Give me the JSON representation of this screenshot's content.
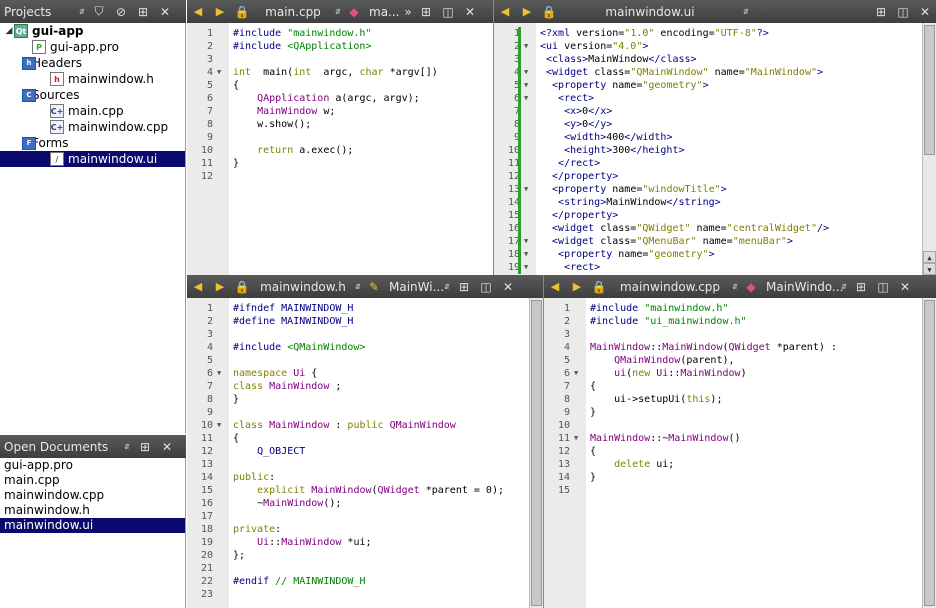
{
  "projects_panel": {
    "title": "Projects",
    "tree": [
      {
        "label": "gui-app",
        "icon": "qt-project-icon",
        "bold": true,
        "expanded": true,
        "level": 0
      },
      {
        "label": "gui-app.pro",
        "icon": "pro-file-icon",
        "level": 1
      },
      {
        "label": "Headers",
        "icon": "headers-folder-icon",
        "expanded": true,
        "level": 1
      },
      {
        "label": "mainwindow.h",
        "icon": "header-file-icon",
        "level": 2
      },
      {
        "label": "Sources",
        "icon": "sources-folder-icon",
        "expanded": true,
        "level": 1
      },
      {
        "label": "main.cpp",
        "icon": "cpp-file-icon",
        "level": 2
      },
      {
        "label": "mainwindow.cpp",
        "icon": "cpp-file-icon",
        "level": 2
      },
      {
        "label": "Forms",
        "icon": "forms-folder-icon",
        "expanded": true,
        "level": 1
      },
      {
        "label": "mainwindow.ui",
        "icon": "ui-file-icon",
        "level": 2,
        "selected": true
      }
    ]
  },
  "open_documents": {
    "title": "Open Documents",
    "items": [
      {
        "label": "gui-app.pro"
      },
      {
        "label": "main.cpp"
      },
      {
        "label": "mainwindow.cpp"
      },
      {
        "label": "mainwindow.h"
      },
      {
        "label": "mainwindow.ui",
        "selected": true
      }
    ]
  },
  "editors": {
    "main_cpp": {
      "file": "main.cpp",
      "symbol": "ma...",
      "lines": [
        [
          [
            "pp",
            "#include "
          ],
          [
            "inc",
            "\"mainwindow.h\""
          ]
        ],
        [
          [
            "pp",
            "#include "
          ],
          [
            "inc",
            "<QApplication>"
          ]
        ],
        [],
        [
          [
            "kw",
            "int"
          ],
          [
            "",
            "  main("
          ],
          [
            "kw",
            "int"
          ],
          [
            "",
            "  argc, "
          ],
          [
            "kw",
            "char"
          ],
          [
            "",
            " *argv[])"
          ]
        ],
        [
          [
            "",
            "{"
          ]
        ],
        [
          [
            "",
            "    "
          ],
          [
            "ty",
            "QApplication"
          ],
          [
            "",
            " a(argc, argv);"
          ]
        ],
        [
          [
            "",
            "    "
          ],
          [
            "ty",
            "MainWindow"
          ],
          [
            "",
            " w;"
          ]
        ],
        [
          [
            "",
            "    w.show();"
          ]
        ],
        [],
        [
          [
            "",
            "    "
          ],
          [
            "kw",
            "return"
          ],
          [
            "",
            " a.exec();"
          ]
        ],
        [
          [
            "",
            "}"
          ]
        ],
        []
      ],
      "folds": [
        4
      ]
    },
    "mainwindow_ui": {
      "file": "mainwindow.ui",
      "lines": [
        [
          [
            "xm",
            "<?xml"
          ],
          [
            "",
            " version="
          ],
          [
            "xa",
            "\"1.0\""
          ],
          [
            "",
            " encoding="
          ],
          [
            "xa",
            "\"UTF-8\""
          ],
          [
            "xm",
            "?>"
          ]
        ],
        [
          [
            "xm",
            "<ui"
          ],
          [
            "",
            " version="
          ],
          [
            "xa",
            "\"4.0\""
          ],
          [
            "xm",
            ">"
          ]
        ],
        [
          [
            "",
            ""
          ],
          [
            "xm",
            " <class>"
          ],
          [
            "",
            "MainWindow"
          ],
          [
            "xm",
            "</class>"
          ]
        ],
        [
          [
            "xm",
            " <widget"
          ],
          [
            "",
            " class="
          ],
          [
            "xa",
            "\"QMainWindow\""
          ],
          [
            "",
            " name="
          ],
          [
            "xa",
            "\"MainWindow\""
          ],
          [
            "xm",
            ">"
          ]
        ],
        [
          [
            "xm",
            "  <property"
          ],
          [
            "",
            " name="
          ],
          [
            "xa",
            "\"geometry\""
          ],
          [
            "xm",
            ">"
          ]
        ],
        [
          [
            "xm",
            "   <rect>"
          ]
        ],
        [
          [
            "xm",
            "    <x>"
          ],
          [
            "",
            "0"
          ],
          [
            "xm",
            "</x>"
          ]
        ],
        [
          [
            "xm",
            "    <y>"
          ],
          [
            "",
            "0"
          ],
          [
            "xm",
            "</y>"
          ]
        ],
        [
          [
            "xm",
            "    <width>"
          ],
          [
            "",
            "400"
          ],
          [
            "xm",
            "</width>"
          ]
        ],
        [
          [
            "xm",
            "    <height>"
          ],
          [
            "",
            "300"
          ],
          [
            "xm",
            "</height>"
          ]
        ],
        [
          [
            "xm",
            "   </rect>"
          ]
        ],
        [
          [
            "xm",
            "  </property>"
          ]
        ],
        [
          [
            "xm",
            "  <property"
          ],
          [
            "",
            " name="
          ],
          [
            "xa",
            "\"windowTitle\""
          ],
          [
            "xm",
            ">"
          ]
        ],
        [
          [
            "xm",
            "   <string>"
          ],
          [
            "",
            "MainWindow"
          ],
          [
            "xm",
            "</string>"
          ]
        ],
        [
          [
            "xm",
            "  </property>"
          ]
        ],
        [
          [
            "xm",
            "  <widget"
          ],
          [
            "",
            " class="
          ],
          [
            "xa",
            "\"QWidget\""
          ],
          [
            "",
            " name="
          ],
          [
            "xa",
            "\"centralWidget\""
          ],
          [
            "xm",
            "/>"
          ]
        ],
        [
          [
            "xm",
            "  <widget"
          ],
          [
            "",
            " class="
          ],
          [
            "xa",
            "\"QMenuBar\""
          ],
          [
            "",
            " name="
          ],
          [
            "xa",
            "\"menuBar\""
          ],
          [
            "xm",
            ">"
          ]
        ],
        [
          [
            "xm",
            "   <property"
          ],
          [
            "",
            " name="
          ],
          [
            "xa",
            "\"geometry\""
          ],
          [
            "xm",
            ">"
          ]
        ],
        [
          [
            "xm",
            "    <rect>"
          ]
        ]
      ],
      "folds": [
        2,
        4,
        5,
        6,
        13,
        17,
        18,
        19
      ]
    },
    "mainwindow_h": {
      "file": "mainwindow.h",
      "symbol": "MainWi...",
      "lines": [
        [
          [
            "pp",
            "#ifndef MAINWINDOW_H"
          ]
        ],
        [
          [
            "pp",
            "#define MAINWINDOW_H"
          ]
        ],
        [],
        [
          [
            "pp",
            "#include "
          ],
          [
            "inc",
            "<QMainWindow>"
          ]
        ],
        [],
        [
          [
            "kw",
            "namespace"
          ],
          [
            "",
            " "
          ],
          [
            "ty",
            "Ui"
          ],
          [
            "",
            " {"
          ]
        ],
        [
          [
            "kw",
            "class"
          ],
          [
            "",
            " "
          ],
          [
            "ty",
            "MainWindow"
          ],
          [
            ";",
            " ;"
          ]
        ],
        [
          [
            "",
            "}"
          ]
        ],
        [],
        [
          [
            "kw",
            "class"
          ],
          [
            "",
            " "
          ],
          [
            "ty",
            "MainWindow"
          ],
          [
            "",
            " : "
          ],
          [
            "kw",
            "public"
          ],
          [
            "",
            " "
          ],
          [
            "ty",
            "QMainWindow"
          ]
        ],
        [
          [
            "",
            "{"
          ]
        ],
        [
          [
            "",
            "    "
          ],
          [
            "nm",
            "Q_OBJECT"
          ]
        ],
        [],
        [
          [
            "kw",
            "public"
          ],
          [
            "",
            ":"
          ]
        ],
        [
          [
            "",
            "    "
          ],
          [
            "kw",
            "explicit"
          ],
          [
            "",
            " "
          ],
          [
            "ty",
            "MainWindow"
          ],
          [
            "",
            "("
          ],
          [
            "ty",
            "QWidget"
          ],
          [
            "",
            " *parent = 0);"
          ]
        ],
        [
          [
            "",
            "    ~"
          ],
          [
            "ty",
            "MainWindow"
          ],
          [
            "",
            "();"
          ]
        ],
        [],
        [
          [
            "kw",
            "private"
          ],
          [
            "",
            ":"
          ]
        ],
        [
          [
            "",
            "    "
          ],
          [
            "ty",
            "Ui"
          ],
          [
            "",
            "::"
          ],
          [
            "ty",
            "MainWindow"
          ],
          [
            "",
            " *ui;"
          ]
        ],
        [
          [
            "",
            "};"
          ]
        ],
        [],
        [
          [
            "pp",
            "#endif "
          ],
          [
            "cm",
            "// MAINWINDOW_H"
          ]
        ],
        []
      ],
      "folds": [
        6,
        10
      ]
    },
    "mainwindow_cpp": {
      "file": "mainwindow.cpp",
      "symbol": "MainWindo...",
      "lines": [
        [
          [
            "pp",
            "#include "
          ],
          [
            "inc",
            "\"mainwindow.h\""
          ]
        ],
        [
          [
            "pp",
            "#include "
          ],
          [
            "inc",
            "\"ui_mainwindow.h\""
          ]
        ],
        [],
        [
          [
            "ty",
            "MainWindow"
          ],
          [
            "",
            "::"
          ],
          [
            "ty",
            "MainWindow"
          ],
          [
            "",
            "("
          ],
          [
            "ty",
            "QWidget"
          ],
          [
            "",
            " *parent) :"
          ]
        ],
        [
          [
            "",
            "    "
          ],
          [
            "ty",
            "QMainWindow"
          ],
          [
            "",
            "(parent),"
          ]
        ],
        [
          [
            "",
            "    "
          ],
          [
            "ty",
            "ui"
          ],
          [
            "",
            "("
          ],
          [
            "kw",
            "new"
          ],
          [
            "",
            " "
          ],
          [
            "ty",
            "Ui"
          ],
          [
            "",
            "::"
          ],
          [
            "ty",
            "MainWindow"
          ],
          [
            "",
            ")"
          ]
        ],
        [
          [
            "",
            "{"
          ]
        ],
        [
          [
            "",
            "    ui->setupUi("
          ],
          [
            "kw",
            "this"
          ],
          [
            "",
            ");"
          ]
        ],
        [
          [
            "",
            "}"
          ]
        ],
        [],
        [
          [
            "ty",
            "MainWindow"
          ],
          [
            "",
            "::~"
          ],
          [
            "ty",
            "MainWindow"
          ],
          [
            "",
            "()"
          ]
        ],
        [
          [
            "",
            "{"
          ]
        ],
        [
          [
            "",
            "    "
          ],
          [
            "kw",
            "delete"
          ],
          [
            "",
            " ui;"
          ]
        ],
        [
          [
            "",
            "}"
          ]
        ],
        []
      ],
      "folds": [
        6,
        11
      ]
    }
  }
}
